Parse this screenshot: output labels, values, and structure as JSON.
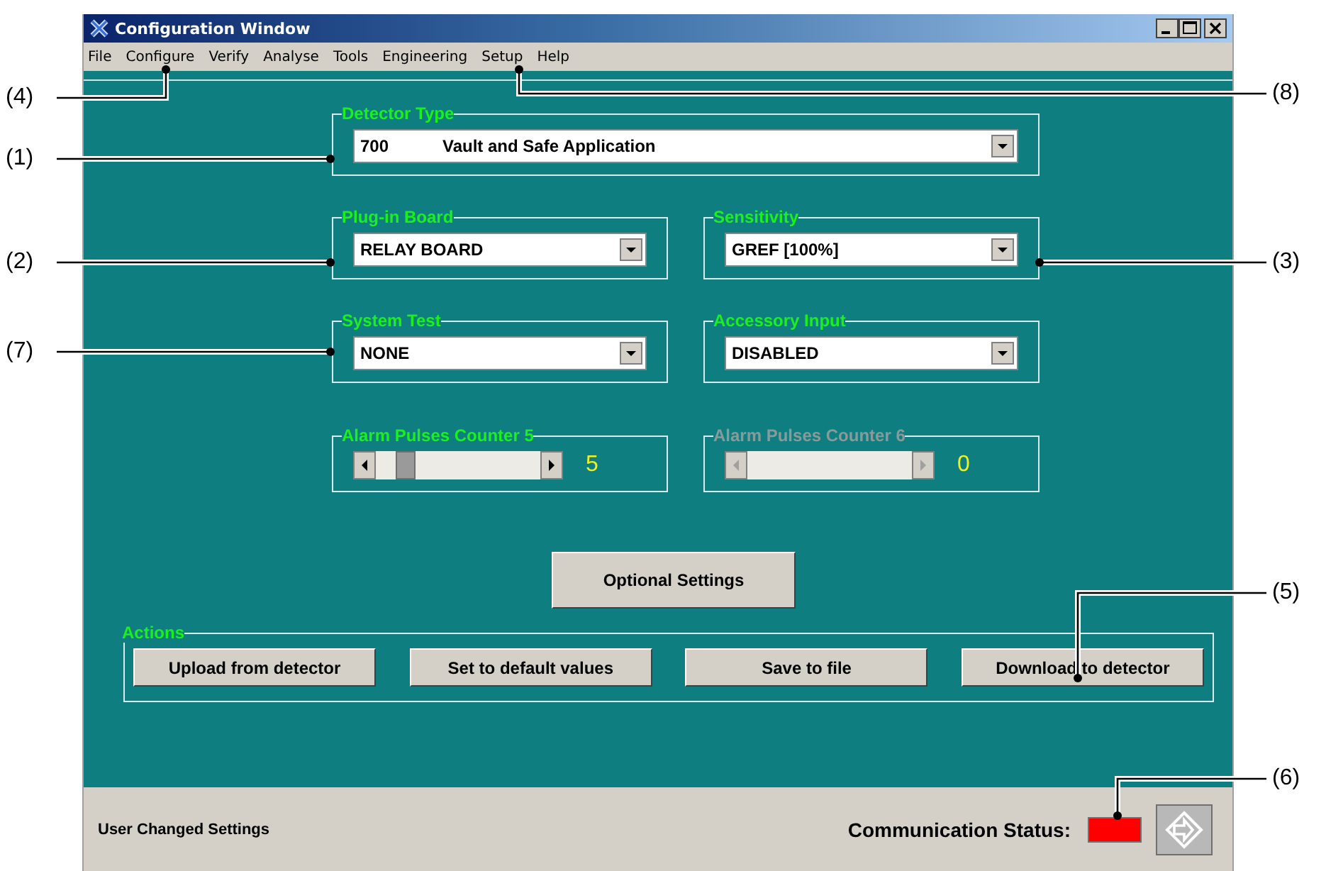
{
  "window": {
    "title": "Configuration Window"
  },
  "menu": [
    "File",
    "Configure",
    "Verify",
    "Analyse",
    "Tools",
    "Engineering",
    "Setup",
    "Help"
  ],
  "detector_type": {
    "label": "Detector Type",
    "code": "700",
    "value": "Vault and Safe Application"
  },
  "dropdowns": [
    {
      "label": "Plug-in Board",
      "value": "RELAY BOARD"
    },
    {
      "label": "Sensitivity",
      "value": "GREF [100%]"
    },
    {
      "label": "System Test",
      "value": "NONE"
    },
    {
      "label": "Accessory Input",
      "value": "DISABLED"
    }
  ],
  "counters": [
    {
      "label": "Alarm Pulses Counter 5",
      "reading": "5",
      "disabled": false
    },
    {
      "label": "Alarm Pulses Counter 6",
      "reading": "0",
      "disabled": true
    }
  ],
  "optional_button": "Optional Settings",
  "actions": {
    "label": "Actions",
    "buttons": [
      "Upload from detector",
      "Set to default values",
      "Save to file",
      "Download to detector"
    ]
  },
  "status_bar": {
    "message": "User Changed Settings",
    "comm_label": "Communication Status:",
    "connected": false
  },
  "callouts": [
    {
      "label": "(4)"
    },
    {
      "label": "(8)"
    },
    {
      "label": "(1)"
    },
    {
      "label": "(2)"
    },
    {
      "label": "(3)"
    },
    {
      "label": "(7)"
    },
    {
      "label": "(5)"
    },
    {
      "label": "(6)"
    }
  ]
}
